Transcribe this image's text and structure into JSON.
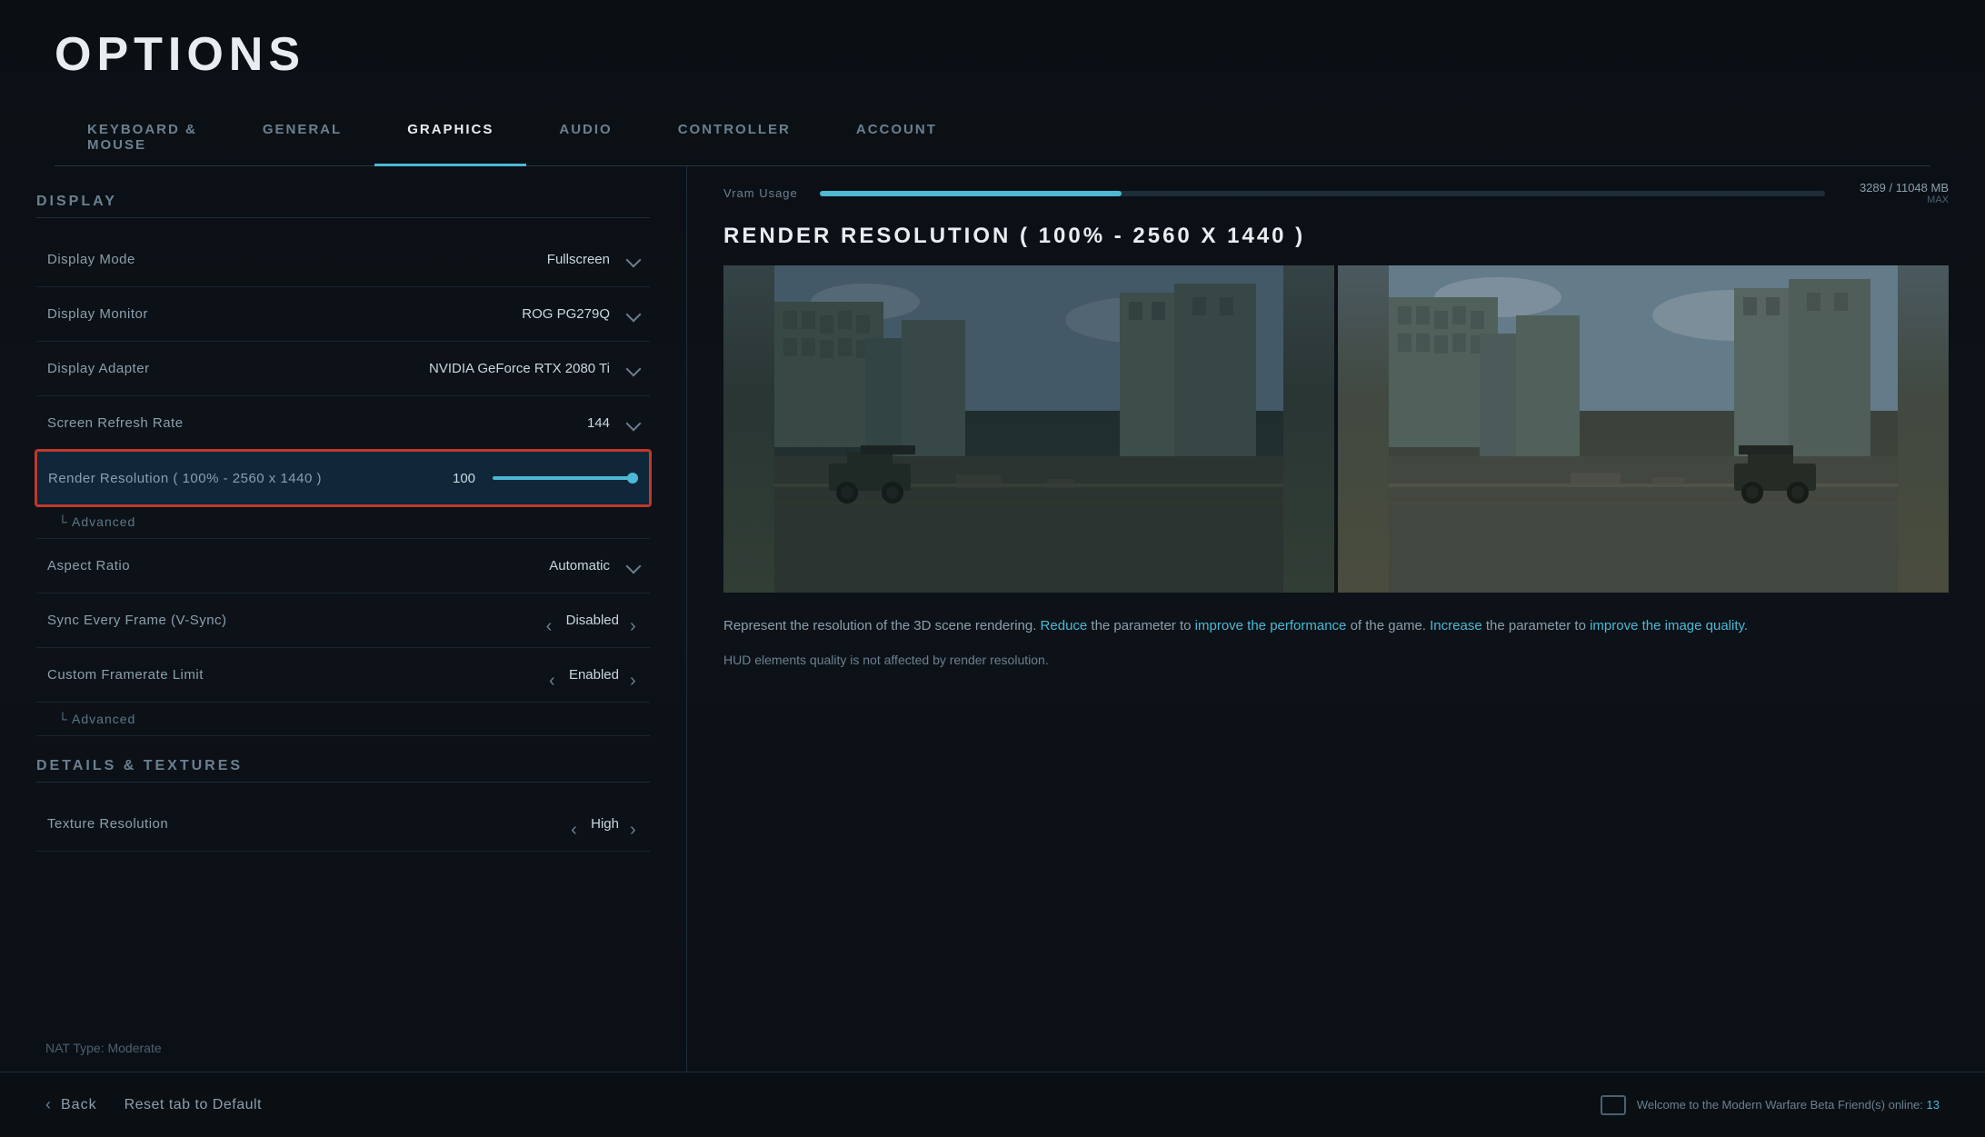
{
  "page": {
    "title": "OPTIONS"
  },
  "nav": {
    "tabs": [
      {
        "id": "keyboard-mouse",
        "label": "KEYBOARD &\nMOUSE",
        "active": false
      },
      {
        "id": "general",
        "label": "GENERAL",
        "active": false
      },
      {
        "id": "graphics",
        "label": "GRAPHICS",
        "active": true
      },
      {
        "id": "audio",
        "label": "AUDIO",
        "active": false
      },
      {
        "id": "controller",
        "label": "CONTROLLER",
        "active": false
      },
      {
        "id": "account",
        "label": "ACCOUNT",
        "active": false
      }
    ]
  },
  "settings": {
    "display_section": "DISPLAY",
    "items": [
      {
        "label": "Display Mode",
        "value": "Fullscreen",
        "type": "dropdown"
      },
      {
        "label": "Display Monitor",
        "value": "ROG PG279Q",
        "type": "dropdown"
      },
      {
        "label": "Display Adapter",
        "value": "NVIDIA GeForce RTX 2080 Ti",
        "type": "dropdown"
      },
      {
        "label": "Screen Refresh Rate",
        "value": "144",
        "type": "dropdown"
      },
      {
        "label": "Render Resolution ( 100% - 2560 x 1440 )",
        "value": "100",
        "type": "slider",
        "slider_value": 100,
        "highlighted": true
      },
      {
        "label": "Advanced",
        "type": "advanced"
      },
      {
        "label": "Aspect Ratio",
        "value": "Automatic",
        "type": "dropdown"
      },
      {
        "label": "Sync Every Frame (V-Sync)",
        "value": "Disabled",
        "type": "arrows"
      },
      {
        "label": "Custom Framerate Limit",
        "value": "Enabled",
        "type": "arrows"
      },
      {
        "label": "Advanced",
        "type": "advanced"
      },
      {
        "label": "Texture Resolution",
        "value": "High",
        "type": "arrows"
      }
    ],
    "details_section": "DETAILS & TEXTURES"
  },
  "vram": {
    "label": "Vram Usage",
    "current": "3289",
    "total": "11048",
    "unit": "MB",
    "max_label": "MAX",
    "display": "3289 / 11048 MB",
    "fill_percent": 30
  },
  "preview": {
    "title": "RENDER RESOLUTION ( 100% - 2560 X 1440 )",
    "description_1": "Represent the resolution of the 3D scene rendering. ",
    "reduce_text": "Reduce",
    "description_2": " the parameter to ",
    "improve_perf_text": "improve the performance",
    "description_3": " of the game. ",
    "increase_text": "Increase",
    "description_4": " the parameter to ",
    "improve_quality_text": "improve the image quality.",
    "note": "HUD elements quality is not affected by render resolution."
  },
  "footer": {
    "back_label": "Back",
    "reset_label": "Reset tab to Default",
    "status": "Welcome to the Modern Warfare Beta",
    "friends_label": "Friend(s) online:",
    "friends_count": "13"
  },
  "nat_type": {
    "label": "NAT Type: Moderate"
  }
}
